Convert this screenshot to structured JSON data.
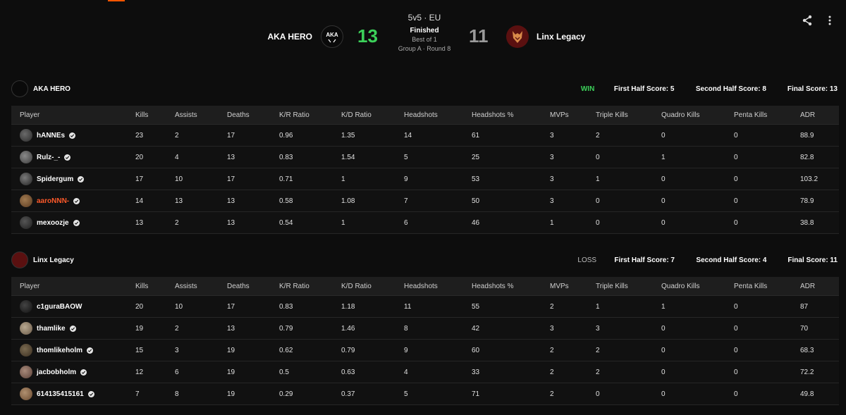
{
  "match": {
    "format": "5v5 · EU",
    "status": "Finished",
    "best_of": "Best of 1",
    "round": "Group A · Round 8",
    "team1": {
      "name": "AKA HERO",
      "score": "13",
      "logo_text": "AKA"
    },
    "team2": {
      "name": "Linx Legacy",
      "score": "11"
    }
  },
  "colors": {
    "win": "#3cd15a",
    "loss_score": "#9a9a9a",
    "accent": "#ff5500",
    "highlight_player": "#ff5a2a"
  },
  "icons": {
    "share": "share-icon",
    "more": "more-vertical-icon",
    "verified": "verified-check-icon"
  },
  "columns": [
    "Player",
    "Kills",
    "Assists",
    "Deaths",
    "K/R Ratio",
    "K/D Ratio",
    "Headshots",
    "Headshots %",
    "MVPs",
    "Triple Kills",
    "Quadro Kills",
    "Penta Kills",
    "ADR"
  ],
  "teams": [
    {
      "name": "AKA HERO",
      "result": "WIN",
      "first_half": "First Half Score: 5",
      "second_half": "Second Half Score: 8",
      "final": "Final Score: 13",
      "players": [
        {
          "name": "hANNEs",
          "verified": true,
          "highlight": false,
          "stats": [
            "23",
            "2",
            "17",
            "0.96",
            "1.35",
            "14",
            "61",
            "3",
            "2",
            "0",
            "0",
            "88.9"
          ]
        },
        {
          "name": "Rulz-_-",
          "verified": true,
          "highlight": false,
          "stats": [
            "20",
            "4",
            "13",
            "0.83",
            "1.54",
            "5",
            "25",
            "3",
            "0",
            "1",
            "0",
            "82.8"
          ]
        },
        {
          "name": "Spidergum",
          "verified": true,
          "highlight": false,
          "stats": [
            "17",
            "10",
            "17",
            "0.71",
            "1",
            "9",
            "53",
            "3",
            "1",
            "0",
            "0",
            "103.2"
          ]
        },
        {
          "name": "aaroNNN-",
          "verified": true,
          "highlight": true,
          "stats": [
            "14",
            "13",
            "13",
            "0.58",
            "1.08",
            "7",
            "50",
            "3",
            "0",
            "0",
            "0",
            "78.9"
          ]
        },
        {
          "name": "mexoozje",
          "verified": true,
          "highlight": false,
          "stats": [
            "13",
            "2",
            "13",
            "0.54",
            "1",
            "6",
            "46",
            "1",
            "0",
            "0",
            "0",
            "38.8"
          ]
        }
      ]
    },
    {
      "name": "Linx Legacy",
      "result": "LOSS",
      "first_half": "First Half Score: 7",
      "second_half": "Second Half Score: 4",
      "final": "Final Score: 11",
      "players": [
        {
          "name": "c1guraBAOW",
          "verified": false,
          "highlight": false,
          "stats": [
            "20",
            "10",
            "17",
            "0.83",
            "1.18",
            "11",
            "55",
            "2",
            "1",
            "1",
            "0",
            "87"
          ]
        },
        {
          "name": "thamlike",
          "verified": true,
          "highlight": false,
          "stats": [
            "19",
            "2",
            "13",
            "0.79",
            "1.46",
            "8",
            "42",
            "3",
            "3",
            "0",
            "0",
            "70"
          ]
        },
        {
          "name": "thomlikeholm",
          "verified": true,
          "highlight": false,
          "stats": [
            "15",
            "3",
            "19",
            "0.62",
            "0.79",
            "9",
            "60",
            "2",
            "2",
            "0",
            "0",
            "68.3"
          ]
        },
        {
          "name": "jacbobholm",
          "verified": true,
          "highlight": false,
          "stats": [
            "12",
            "6",
            "19",
            "0.5",
            "0.63",
            "4",
            "33",
            "2",
            "2",
            "0",
            "0",
            "72.2"
          ]
        },
        {
          "name": "614135415161",
          "verified": true,
          "highlight": false,
          "stats": [
            "7",
            "8",
            "19",
            "0.29",
            "0.37",
            "5",
            "71",
            "2",
            "0",
            "0",
            "0",
            "49.8"
          ]
        }
      ]
    }
  ]
}
